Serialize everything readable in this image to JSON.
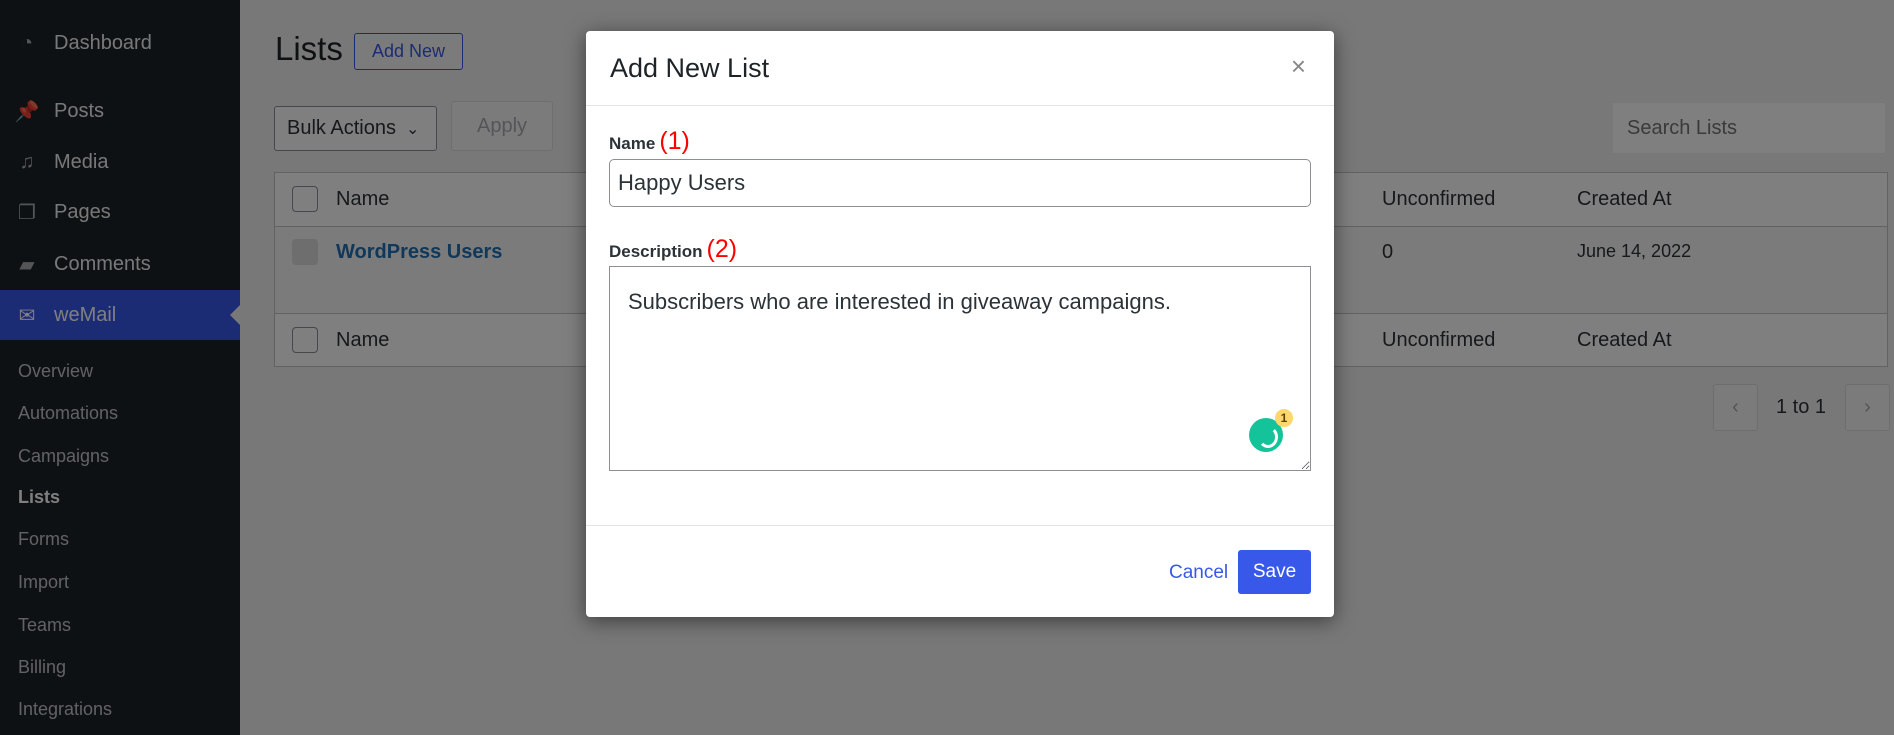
{
  "sidebar": {
    "menu": [
      {
        "label": "Dashboard",
        "icon": "dashboard-icon"
      },
      {
        "label": "Posts",
        "icon": "pin-icon"
      },
      {
        "label": "Media",
        "icon": "media-icon"
      },
      {
        "label": "Pages",
        "icon": "pages-icon"
      },
      {
        "label": "Comments",
        "icon": "comment-icon"
      },
      {
        "label": "weMail",
        "icon": "envelope-icon",
        "active": true
      }
    ],
    "submenu": [
      "Overview",
      "Automations",
      "Campaigns",
      "Lists",
      "Forms",
      "Import",
      "Teams",
      "Billing",
      "Integrations"
    ],
    "current": "Lists"
  },
  "page": {
    "title": "Lists",
    "add_new": "Add New",
    "bulk_actions": "Bulk Actions",
    "apply": "Apply",
    "search_placeholder": "Search Lists",
    "table": {
      "columns": [
        "Name",
        "Unconfirmed",
        "Created At"
      ],
      "rows": [
        {
          "name": "WordPress Users",
          "unconfirmed": "0",
          "created_at": "June 14, 2022"
        }
      ]
    },
    "pagination": {
      "text": "1 to 1"
    }
  },
  "modal": {
    "title": "Add New List",
    "close": "×",
    "name_label": "Name",
    "name_annotation": "(1)",
    "name_value": "Happy Users",
    "description_label": "Description",
    "description_annotation": "(2)",
    "description_value": "Subscribers who are interested in giveaway campaigns.",
    "grammarly_count": "1",
    "cancel": "Cancel",
    "save": "Save"
  },
  "colors": {
    "accent": "#3858e9",
    "annotation": "#ff0000",
    "grammarly": "#15c39a"
  }
}
